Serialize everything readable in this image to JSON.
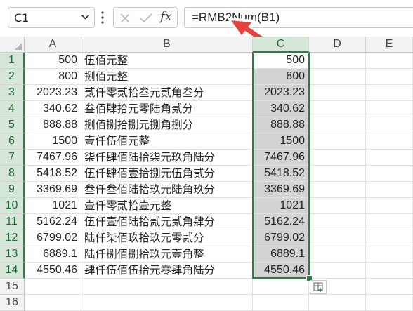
{
  "formula_bar": {
    "name_box": "C1",
    "formula": "=RMB2Num(B1)",
    "fx_label": "fx"
  },
  "columns": [
    "A",
    "B",
    "C",
    "D",
    "E"
  ],
  "rows": [
    {
      "num": "1",
      "a": "500",
      "b": "伍佰元整",
      "c": "500"
    },
    {
      "num": "2",
      "a": "800",
      "b": "捌佰元整",
      "c": "800"
    },
    {
      "num": "3",
      "a": "2023.23",
      "b": "贰仟零贰拾叁元贰角叁分",
      "c": "2023.23"
    },
    {
      "num": "4",
      "a": "340.62",
      "b": "叁佰肆拾元零陆角贰分",
      "c": "340.62"
    },
    {
      "num": "5",
      "a": "888.88",
      "b": "捌佰捌拾捌元捌角捌分",
      "c": "888.88"
    },
    {
      "num": "6",
      "a": "1500",
      "b": "壹仟伍佰元整",
      "c": "1500"
    },
    {
      "num": "7",
      "a": "7467.96",
      "b": "柒仟肆佰陆拾柒元玖角陆分",
      "c": "7467.96"
    },
    {
      "num": "8",
      "a": "5418.52",
      "b": "伍仟肆佰壹拾捌元伍角贰分",
      "c": "5418.52"
    },
    {
      "num": "9",
      "a": "3369.69",
      "b": "叁仟叁佰陆拾玖元陆角玖分",
      "c": "3369.69"
    },
    {
      "num": "10",
      "a": "1021",
      "b": "壹仟零贰拾壹元整",
      "c": "1021"
    },
    {
      "num": "11",
      "a": "5162.24",
      "b": "伍仟壹佰陆拾贰元贰角肆分",
      "c": "5162.24"
    },
    {
      "num": "12",
      "a": "6799.02",
      "b": "陆仟柒佰玖拾玖元零贰分",
      "c": "6799.02"
    },
    {
      "num": "13",
      "a": "6889.1",
      "b": "陆仟捌佰捌拾玖元壹角整",
      "c": "6889.1"
    },
    {
      "num": "14",
      "a": "4550.46",
      "b": "肆仟伍佰伍拾元零肆角陆分",
      "c": "4550.46"
    },
    {
      "num": "15",
      "a": "",
      "b": "",
      "c": ""
    },
    {
      "num": "16",
      "a": "",
      "b": "",
      "c": ""
    }
  ],
  "colors": {
    "selection_border": "#2e7d46",
    "selected_header_bg": "#d6e6d8",
    "selected_cell_bg": "#d3d3d3",
    "annotation_arrow": "#e8413c"
  },
  "icons": [
    "chevron-down-icon",
    "more-vertical-icon",
    "cancel-x-icon",
    "confirm-check-icon",
    "insert-function-icon",
    "select-all-triangle-icon",
    "quick-analysis-icon",
    "annotation-arrow-icon"
  ]
}
